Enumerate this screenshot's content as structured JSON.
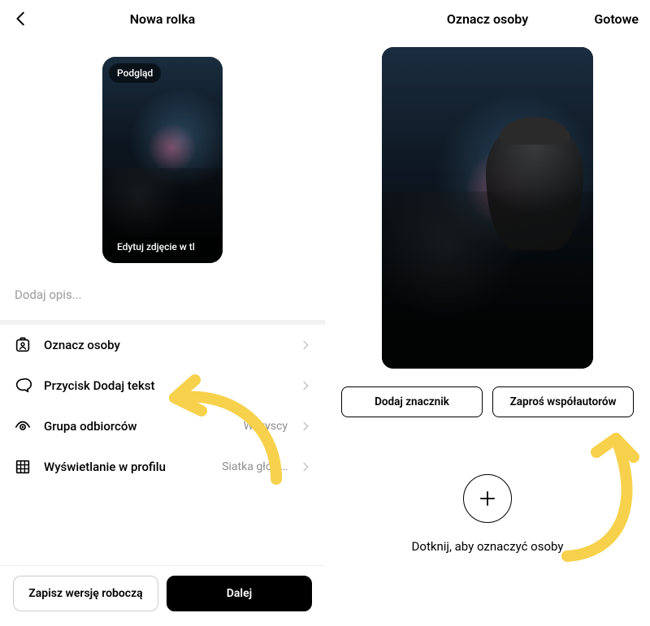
{
  "left": {
    "header": {
      "title": "Nowa rolka"
    },
    "preview": {
      "top_pill": "Podgląd",
      "bottom_pill": "Edytuj zdjęcie w tl"
    },
    "caption_placeholder": "Dodaj opis...",
    "options": {
      "tag": {
        "label": "Oznacz osoby"
      },
      "text_button": {
        "label": "Przycisk Dodaj tekst"
      },
      "audience": {
        "label": "Grupa odbiorców",
        "value": "Wszyscy"
      },
      "profile_display": {
        "label": "Wyświetlanie w profilu",
        "value": "Siatka głów…"
      }
    },
    "footer": {
      "draft": "Zapisz wersję roboczą",
      "next": "Dalej"
    }
  },
  "right": {
    "header": {
      "title": "Oznacz osoby",
      "done": "Gotowe"
    },
    "buttons": {
      "add_tag": "Dodaj znacznik",
      "invite_collab": "Zaproś współautorów"
    },
    "plus_label": "Dotknij, aby oznaczyć osoby"
  },
  "icons": {
    "back": "back-chevron-icon",
    "chevron": "chevron-right-icon",
    "person_tag": "person-tag-icon",
    "chat": "chat-bubble-icon",
    "eye": "audience-eye-icon",
    "grid": "grid-icon",
    "plus": "plus-icon"
  },
  "colors": {
    "annotation": "#f7d14c"
  }
}
